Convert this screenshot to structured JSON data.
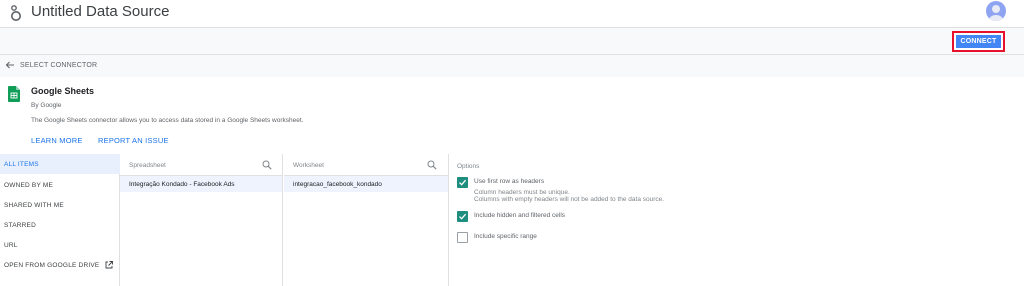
{
  "header": {
    "title": "Untitled Data Source",
    "avatar_color": "#8ea4f2"
  },
  "toolbar": {
    "connect_label": "CONNECT",
    "connect_color": "#4285f4",
    "highlight_color": "#e8112d"
  },
  "back": {
    "label": "SELECT CONNECTOR"
  },
  "connector": {
    "name": "Google Sheets",
    "by": "By Google",
    "description": "The Google Sheets connector allows you to access data stored in a Google Sheets worksheet.",
    "learn_more": "LEARN MORE",
    "report_issue": "REPORT AN ISSUE",
    "icon": "google-sheets-icon"
  },
  "nav": {
    "items": [
      {
        "label": "ALL ITEMS",
        "active": true
      },
      {
        "label": "OWNED BY ME",
        "active": false
      },
      {
        "label": "SHARED WITH ME",
        "active": false
      },
      {
        "label": "STARRED",
        "active": false
      },
      {
        "label": "URL",
        "active": false
      },
      {
        "label": "OPEN FROM GOOGLE DRIVE",
        "active": false,
        "icon": "external-link-icon"
      }
    ]
  },
  "spreadsheet": {
    "header": "Spreadsheet",
    "selected": "Integração Kondado - Facebook Ads"
  },
  "worksheet": {
    "header": "Worksheet",
    "selected": "integracao_facebook_kondado"
  },
  "options": {
    "title": "Options",
    "use_first_row": {
      "label": "Use first row as headers",
      "checked": true,
      "note1": "Column headers must be unique.",
      "note2": "Columns with empty headers will not be added to the data source."
    },
    "include_hidden": {
      "label": "Include hidden and filtered cells",
      "checked": true
    },
    "specific_range": {
      "label": "Include specific range",
      "checked": false
    },
    "check_color": "#1e8e7e"
  }
}
